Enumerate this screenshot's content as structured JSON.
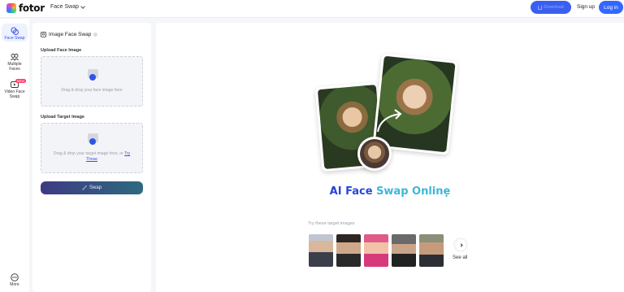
{
  "header": {
    "logo_text": "fotor",
    "tool_menu_label": "Face Swap",
    "download_label": "Download",
    "signup_label": "Sign up",
    "login_label": "Log in"
  },
  "rail": {
    "items": [
      {
        "label": "Face Swap",
        "icon": "face-swap-icon",
        "active": true
      },
      {
        "label": "Multiple Faces",
        "icon": "multiple-faces-icon"
      },
      {
        "label": "Video Face Swap",
        "icon": "video-face-swap-icon",
        "badge": "NEW"
      }
    ],
    "more_label": "More"
  },
  "panel": {
    "title": "Image Face Swap",
    "face_section_label": "Upload Face Image",
    "face_drop_text": "Drag & drop your face image here",
    "target_section_label": "Upload Target Image",
    "target_drop_text": "Drag & drop your target image here, or",
    "target_try_link": "Try Those",
    "swap_label": "Swap"
  },
  "main": {
    "hero_title_part1": "AI Face ",
    "hero_title_part2": "Swap Online",
    "try_label": "Try these target images",
    "see_all_label": "See all"
  },
  "colors": {
    "accent": "#3367ff",
    "swap_gradient_start": "#3d3a84",
    "swap_gradient_end": "#2f6a7f"
  }
}
